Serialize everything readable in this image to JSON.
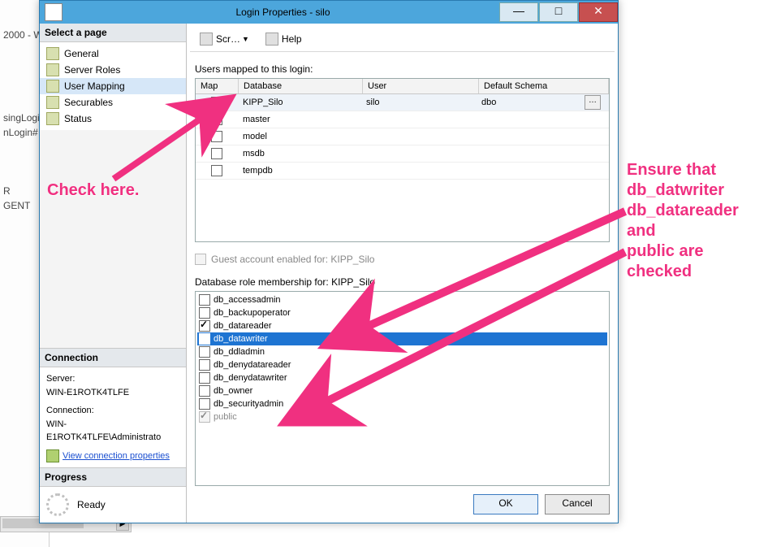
{
  "bg": {
    "lines": [
      "",
      "2000 - W",
      "",
      "",
      "singLogin",
      "nLogin#",
      "",
      "R",
      "GENT"
    ]
  },
  "window": {
    "title": "Login Properties - silo",
    "min": "—",
    "max": "□",
    "close": "✕"
  },
  "side": {
    "select_page": "Select a page",
    "pages": [
      {
        "label": "General"
      },
      {
        "label": "Server Roles"
      },
      {
        "label": "User Mapping",
        "selected": true
      },
      {
        "label": "Securables"
      },
      {
        "label": "Status"
      }
    ],
    "connection_hdr": "Connection",
    "server_lbl": "Server:",
    "server_val": "WIN-E1ROTK4TLFE",
    "conn_lbl": "Connection:",
    "conn_val": "WIN-E1ROTK4TLFE\\Administrato",
    "view_conn": "View connection properties",
    "progress_hdr": "Progress",
    "progress_val": "Ready"
  },
  "toolbar": {
    "script": "Scr…",
    "help": "Help"
  },
  "mapping": {
    "label": "Users mapped to this login:",
    "headers": {
      "map": "Map",
      "db": "Database",
      "user": "User",
      "schema": "Default Schema"
    },
    "rows": [
      {
        "map": true,
        "db": "KIPP_Silo",
        "user": "silo",
        "schema": "dbo",
        "selected": true,
        "ellipsis": true
      },
      {
        "map": false,
        "db": "master",
        "user": "",
        "schema": ""
      },
      {
        "map": false,
        "db": "model",
        "user": "",
        "schema": ""
      },
      {
        "map": false,
        "db": "msdb",
        "user": "",
        "schema": ""
      },
      {
        "map": false,
        "db": "tempdb",
        "user": "",
        "schema": ""
      }
    ]
  },
  "guest": {
    "label": "Guest account enabled for: KIPP_Silo"
  },
  "roles": {
    "label": "Database role membership for: KIPP_Silo",
    "items": [
      {
        "name": "db_accessadmin",
        "checked": false
      },
      {
        "name": "db_backupoperator",
        "checked": false
      },
      {
        "name": "db_datareader",
        "checked": true
      },
      {
        "name": "db_datawriter",
        "checked": true,
        "selected": true
      },
      {
        "name": "db_ddladmin",
        "checked": false
      },
      {
        "name": "db_denydatareader",
        "checked": false
      },
      {
        "name": "db_denydatawriter",
        "checked": false
      },
      {
        "name": "db_owner",
        "checked": false
      },
      {
        "name": "db_securityadmin",
        "checked": false
      },
      {
        "name": "public",
        "checked": true,
        "disabled": true
      }
    ]
  },
  "buttons": {
    "ok": "OK",
    "cancel": "Cancel"
  },
  "annotations": {
    "left": "Check here.",
    "right": "Ensure that\ndb_datwriter\ndb_datareader\nand\npublic are\nchecked"
  }
}
